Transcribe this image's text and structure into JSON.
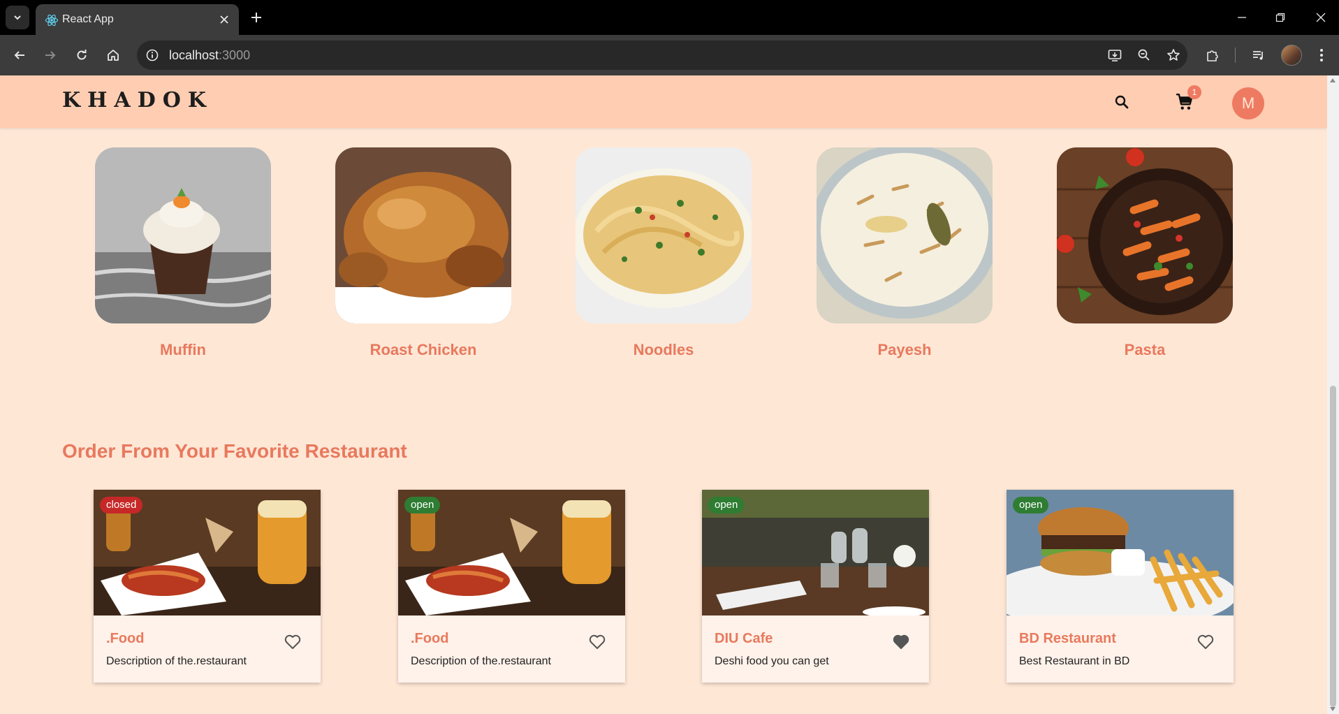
{
  "browser": {
    "tab_title": "React App",
    "url_host": "localhost",
    "url_port": ":3000"
  },
  "header": {
    "logo": "KHADOK",
    "cart_count": "1",
    "avatar_initial": "M"
  },
  "food_items": [
    {
      "name": "Muffin"
    },
    {
      "name": "Roast Chicken"
    },
    {
      "name": "Noodles"
    },
    {
      "name": "Payesh"
    },
    {
      "name": "Pasta"
    }
  ],
  "restaurants_section": {
    "title": "Order From Your Favorite Restaurant",
    "items": [
      {
        "name": ".Food",
        "description": "Description of the.restaurant",
        "status": "closed",
        "favorite": false
      },
      {
        "name": ".Food",
        "description": "Description of the.restaurant",
        "status": "open",
        "favorite": false
      },
      {
        "name": "DIU Cafe",
        "description": "Deshi food you can get",
        "status": "open",
        "favorite": true
      },
      {
        "name": "BD Restaurant",
        "description": "Best Restaurant in BD",
        "status": "open",
        "favorite": false
      }
    ]
  },
  "colors": {
    "accent": "#e8795d",
    "header_bg": "#ffcdb2",
    "page_bg": "#ffe7d6",
    "closed": "#c62828",
    "open": "#2e7d32"
  }
}
